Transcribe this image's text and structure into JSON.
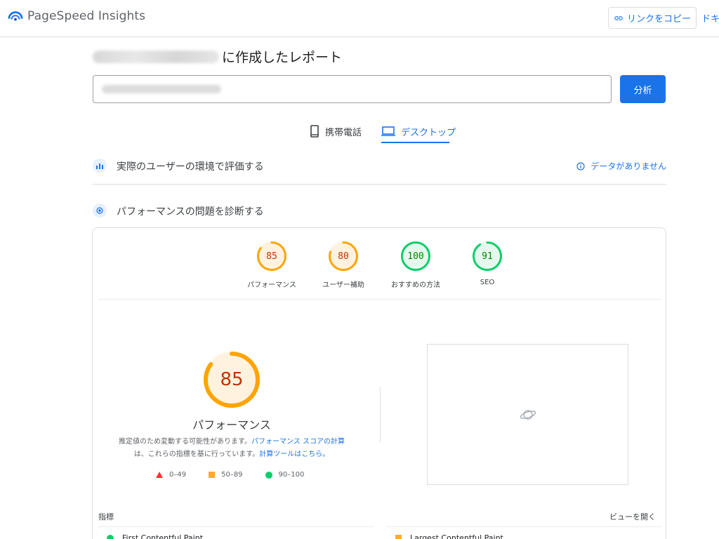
{
  "header": {
    "brand_name": "PageSpeed Insights",
    "copy_link_label": "リンクをコピー",
    "docs_label": "ドキ"
  },
  "report": {
    "title_suffix": "に作成したレポート"
  },
  "search": {
    "analyze_label": "分析"
  },
  "tabs": [
    {
      "label": "携帯電話",
      "selected": false
    },
    {
      "label": "デスクトップ",
      "selected": true
    }
  ],
  "field_data": {
    "label": "実際のユーザーの環境で評価する",
    "no_data": "データがありません"
  },
  "diagnose": {
    "label": "パフォーマンスの問題を診断する"
  },
  "scores": [
    {
      "label": "パフォーマンス",
      "score": "85",
      "value": 85,
      "color": "#ffa400",
      "text_color": "#c33300",
      "fill": "#fff3e0"
    },
    {
      "label": "ユーザー補助",
      "score": "80",
      "value": 80,
      "color": "#ffa400",
      "text_color": "#c33300",
      "fill": "#fff3e0"
    },
    {
      "label": "おすすめの方法",
      "score": "100",
      "value": 100,
      "color": "#0cce6b",
      "text_color": "#008800",
      "fill": "#e6f8ee"
    },
    {
      "label": "SEO",
      "score": "91",
      "value": 91,
      "color": "#0cce6b",
      "text_color": "#008800",
      "fill": "#e6f8ee"
    }
  ],
  "performance": {
    "score": "85",
    "value": 85,
    "title": "パフォーマンス",
    "note_text_1": "推定値のため変動する可能性があります。",
    "note_link_1": "パフォーマンス スコアの計算",
    "note_text_2": "は、これらの指標を基に行っています。",
    "note_link_2": "計算ツールはこちら。"
  },
  "legend": [
    {
      "range": "0–49",
      "shape": "triangle",
      "color": "#ff3333"
    },
    {
      "range": "50–89",
      "shape": "square",
      "color": "#ffaa33"
    },
    {
      "range": "90–100",
      "shape": "circle",
      "color": "#0cce6b"
    }
  ],
  "metrics": {
    "label": "指標",
    "expand_label": "ビューを開く",
    "items": [
      {
        "name": "First Contentful Paint",
        "status": "good"
      },
      {
        "name": "Largest Contentful Paint",
        "status": "average"
      }
    ]
  },
  "colors": {
    "accent": "#1a73e8",
    "average": "#ffa400",
    "good": "#0cce6b",
    "poor": "#ff3333"
  }
}
